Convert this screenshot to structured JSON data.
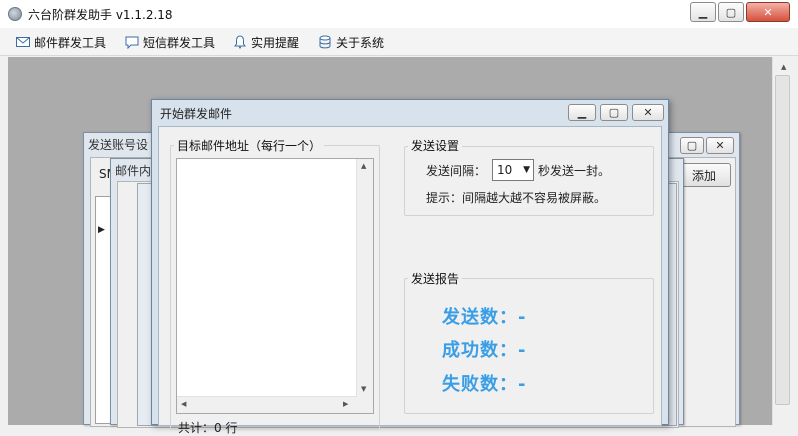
{
  "app": {
    "title": "六台阶群发助手 v1.1.2.18"
  },
  "menu": [
    {
      "label": "邮件群发工具",
      "icon": "mail-icon"
    },
    {
      "label": "短信群发工具",
      "icon": "chat-bubble-icon"
    },
    {
      "label": "实用提醒",
      "icon": "bell-icon"
    },
    {
      "label": "关于系统",
      "icon": "database-icon"
    }
  ],
  "bg_windows": {
    "account_settings": {
      "title": "发送账号设",
      "col_fragment": "SM",
      "add_button": "添加"
    },
    "mail_content": {
      "title": "邮件内"
    }
  },
  "dialog": {
    "title": "开始群发邮件",
    "targets": {
      "label": "目标邮件地址（每行一个）",
      "count_text": "共计：0 行"
    },
    "settings": {
      "label": "发送设置",
      "interval_label": "发送间隔：",
      "interval_value": "10",
      "interval_suffix": "秒发送一封。",
      "hint": "提示：间隔越大越不容易被屏蔽。"
    },
    "report": {
      "label": "发送报告",
      "sent": "发送数：-",
      "success": "成功数：-",
      "failed": "失败数：-"
    }
  },
  "colors": {
    "stat_blue": "#3a9ee6",
    "workarea_gray": "#ababab"
  }
}
